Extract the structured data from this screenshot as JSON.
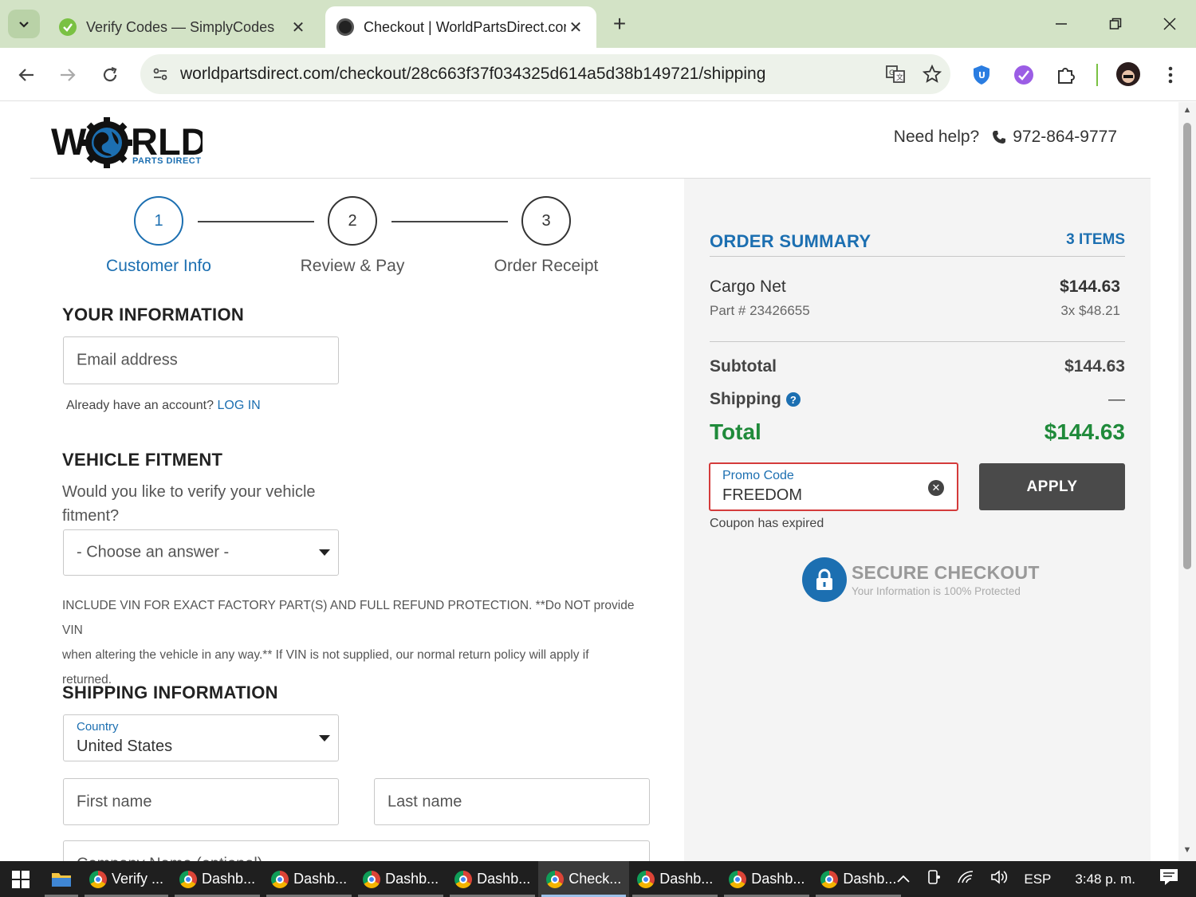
{
  "browser": {
    "tabs": [
      {
        "title": "Verify Codes — SimplyCodes",
        "active": false
      },
      {
        "title": "Checkout | WorldPartsDirect.com",
        "active": true
      }
    ],
    "url": "worldpartsdirect.com/checkout/28c663f37f034325d614a5d38b149721/shipping"
  },
  "header": {
    "logo_text": "W  RLD",
    "logo_sub": "PARTS DIRECT",
    "help_label": "Need help?",
    "phone": "972-864-9777"
  },
  "steps": [
    {
      "num": "1",
      "label": "Customer Info",
      "active": true
    },
    {
      "num": "2",
      "label": "Review & Pay",
      "active": false
    },
    {
      "num": "3",
      "label": "Order Receipt",
      "active": false
    }
  ],
  "your_info": {
    "title": "YOUR INFORMATION",
    "email_placeholder": "Email address",
    "account_prompt": "Already have an account?",
    "login_link": "LOG IN"
  },
  "fitment": {
    "title": "VEHICLE FITMENT",
    "question_line1": "Would you like to verify your vehicle",
    "question_line2": "fitment?",
    "select_value": "- Choose an answer -",
    "vin_note_line1": "INCLUDE VIN FOR EXACT FACTORY PART(S) AND FULL REFUND PROTECTION. **Do NOT provide VIN",
    "vin_note_line2": "when altering the vehicle in any way.** If VIN is not supplied, our normal return policy will apply if",
    "vin_note_line3": "returned."
  },
  "shipping": {
    "title": "SHIPPING INFORMATION",
    "country_label": "Country",
    "country_value": "United States",
    "first_name_placeholder": "First name",
    "last_name_placeholder": "Last name",
    "company_placeholder": "Company Name (optional)"
  },
  "summary": {
    "title": "ORDER SUMMARY",
    "count": "3 ITEMS",
    "item_name": "Cargo Net",
    "item_price": "$144.63",
    "item_part": "Part # 23426655",
    "item_qty": "3x $48.21",
    "subtotal_label": "Subtotal",
    "subtotal_value": "$144.63",
    "shipping_label": "Shipping",
    "shipping_value": "—",
    "total_label": "Total",
    "total_value": "$144.63",
    "promo_label": "Promo Code",
    "promo_value": "FREEDOM",
    "apply_label": "APPLY",
    "coupon_msg": "Coupon has expired",
    "secure_title": "SECURE CHECKOUT",
    "secure_sub": "Your Information is 100% Protected"
  },
  "taskbar": {
    "items": [
      {
        "label": "Verify ...",
        "active": false
      },
      {
        "label": "Dashb...",
        "active": false
      },
      {
        "label": "Dashb...",
        "active": false
      },
      {
        "label": "Dashb...",
        "active": false
      },
      {
        "label": "Dashb...",
        "active": false
      },
      {
        "label": "Check...",
        "active": true
      },
      {
        "label": "Dashb...",
        "active": false
      },
      {
        "label": "Dashb...",
        "active": false
      },
      {
        "label": "Dashb...",
        "active": false
      }
    ],
    "lang": "ESP",
    "time": "3:48 p. m."
  },
  "colors": {
    "brand_blue": "#1c6fb1",
    "total_green": "#1f8a3a",
    "error_red": "#d43b3b",
    "apply_gray": "#4a4a4a"
  }
}
